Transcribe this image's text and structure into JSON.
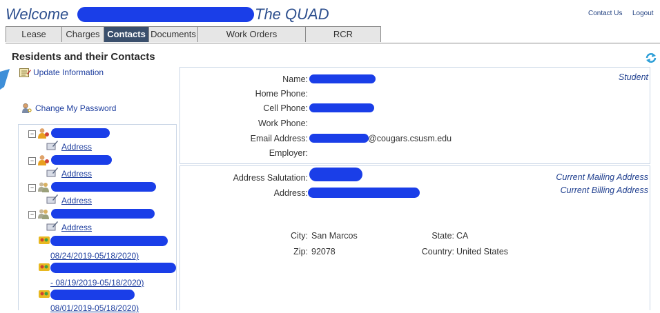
{
  "header": {
    "welcome_text": "Welcome",
    "property_name": "The QUAD",
    "contact_us": "Contact Us",
    "logout": "Logout"
  },
  "tabs": [
    {
      "label": "Lease"
    },
    {
      "label": "Charges"
    },
    {
      "label": "Contacts"
    },
    {
      "label": "Documents"
    },
    {
      "label": "Work Orders"
    },
    {
      "label": "RCR"
    }
  ],
  "section_title": "Residents and their Contacts",
  "sidebar": {
    "update_info": "Update Information",
    "change_password": "Change My Password"
  },
  "tree": {
    "address_label": "Address",
    "lease_dates": [
      "08/24/2019-05/18/2020)",
      "- 08/19/2019-05/18/2020)",
      "08/01/2019-05/18/2020)"
    ]
  },
  "contact_panel": {
    "labels": {
      "name": "Name:",
      "home_phone": "Home Phone:",
      "cell_phone": "Cell Phone:",
      "work_phone": "Work Phone:",
      "email": "Email Address:",
      "employer": "Employer:"
    },
    "email_domain": "@cougars.csusm.edu",
    "role": "Student"
  },
  "address_panel": {
    "labels": {
      "salutation": "Address Salutation:",
      "address": "Address:",
      "city": "City:",
      "zip": "Zip:",
      "state": "State:",
      "country": "Country:"
    },
    "values": {
      "city": "San Marcos",
      "zip": "92078",
      "state": "CA",
      "country": "United States"
    },
    "mailing_tag": "Current Mailing Address",
    "billing_tag": "Current Billing Address"
  },
  "colors": {
    "accent": "#2d4f8e",
    "active_tab": "#3a4f6c",
    "link": "#1f3f9f",
    "redaction": "#1a3ee8"
  }
}
